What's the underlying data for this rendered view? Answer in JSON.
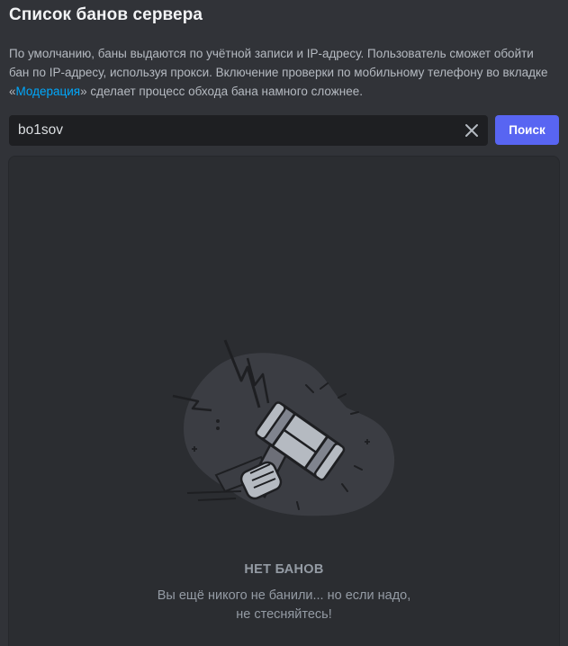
{
  "page": {
    "title": "Список банов сервера"
  },
  "description": {
    "text_before": "По умолчанию, баны выдаются по учётной записи и IP-адресу. Пользователь сможет обойти бан по IP-адресу, используя прокси. Включение проверки по мобильному телефону во вкладке «",
    "link_text": "Модерация",
    "text_after": "» сделает процесс обхода бана намного сложнее."
  },
  "search": {
    "value": "bo1sov",
    "clear_icon": "close-icon",
    "button_label": "Поиск"
  },
  "empty_state": {
    "title": "НЕТ БАНОВ",
    "subtitle_line1": "Вы ещё никого не банили... но если надо,",
    "subtitle_line2": "не стесняйтесь!",
    "illustration_icon": "ban-hammer-icon"
  },
  "colors": {
    "background": "#313338",
    "panel": "#2b2d31",
    "input": "#1e1f22",
    "accent": "#5865f2",
    "link": "#00a8fc"
  }
}
